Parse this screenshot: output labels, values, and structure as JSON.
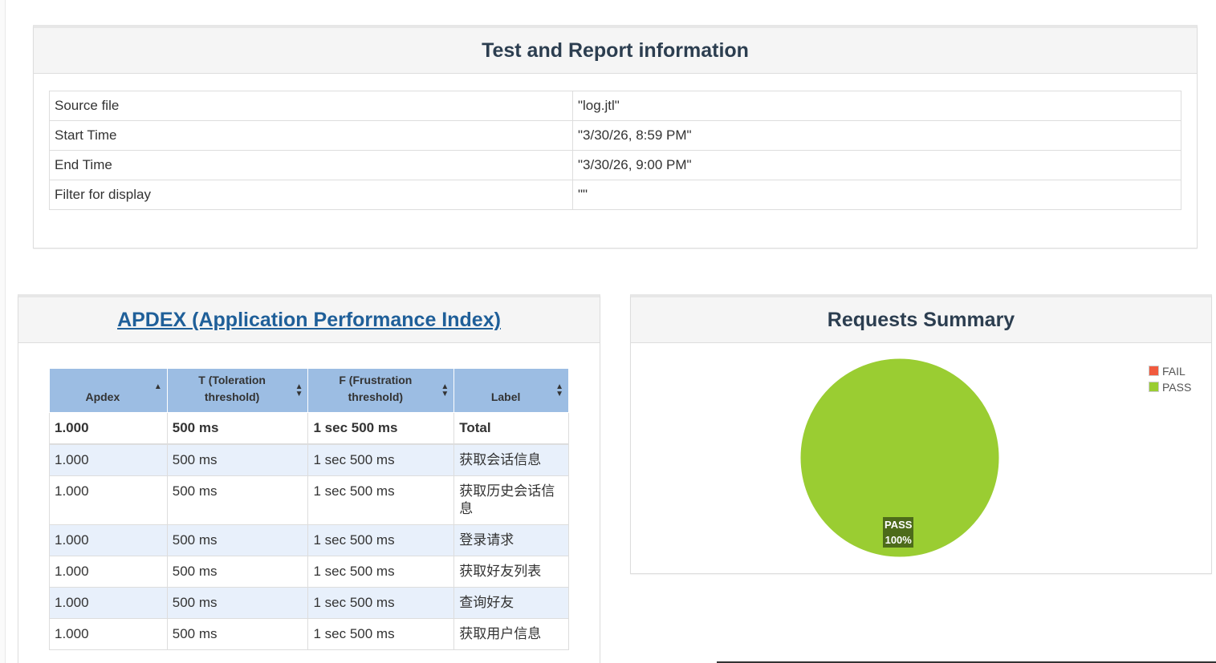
{
  "info": {
    "title": "Test and Report information",
    "rows": [
      {
        "key": "Source file",
        "value": "\"log.jtl\""
      },
      {
        "key": "Start Time",
        "value": "\"3/30/26, 8:59 PM\""
      },
      {
        "key": "End Time",
        "value": "\"3/30/26, 9:00 PM\""
      },
      {
        "key": "Filter for display",
        "value": "\"\""
      }
    ]
  },
  "apdex": {
    "title": "APDEX (Application Performance Index)",
    "headers": [
      "Apdex",
      "T (Toleration threshold)",
      "F (Frustration threshold)",
      "Label"
    ],
    "header_lines": [
      [
        "Apdex"
      ],
      [
        "T (Toleration",
        "threshold)"
      ],
      [
        "F (Frustration",
        "threshold)"
      ],
      [
        "Label"
      ]
    ],
    "total": {
      "apdex": "1.000",
      "t": "500 ms",
      "f": "1 sec 500 ms",
      "label": "Total"
    },
    "rows": [
      {
        "apdex": "1.000",
        "t": "500 ms",
        "f": "1 sec 500 ms",
        "label": "获取会话信息"
      },
      {
        "apdex": "1.000",
        "t": "500 ms",
        "f": "1 sec 500 ms",
        "label": "获取历史会话信息"
      },
      {
        "apdex": "1.000",
        "t": "500 ms",
        "f": "1 sec 500 ms",
        "label": "登录请求"
      },
      {
        "apdex": "1.000",
        "t": "500 ms",
        "f": "1 sec 500 ms",
        "label": "获取好友列表"
      },
      {
        "apdex": "1.000",
        "t": "500 ms",
        "f": "1 sec 500 ms",
        "label": "查询好友"
      },
      {
        "apdex": "1.000",
        "t": "500 ms",
        "f": "1 sec 500 ms",
        "label": "获取用户信息"
      }
    ]
  },
  "summary": {
    "title": "Requests Summary",
    "legend": [
      {
        "name": "FAIL",
        "color": "#f15a3e"
      },
      {
        "name": "PASS",
        "color": "#9acd32"
      }
    ],
    "pie_label": {
      "name": "PASS",
      "percent": "100%"
    }
  },
  "chart_data": {
    "type": "pie",
    "title": "Requests Summary",
    "slices": [
      {
        "label": "FAIL",
        "value": 0,
        "color": "#f15a3e"
      },
      {
        "label": "PASS",
        "value": 100,
        "color": "#9acd32"
      }
    ],
    "legend": "top-right"
  },
  "colors": {
    "header_bg": "#9cbde3",
    "alt_row": "#e8f0fb",
    "pass": "#9acd32",
    "fail": "#f15a3e"
  }
}
